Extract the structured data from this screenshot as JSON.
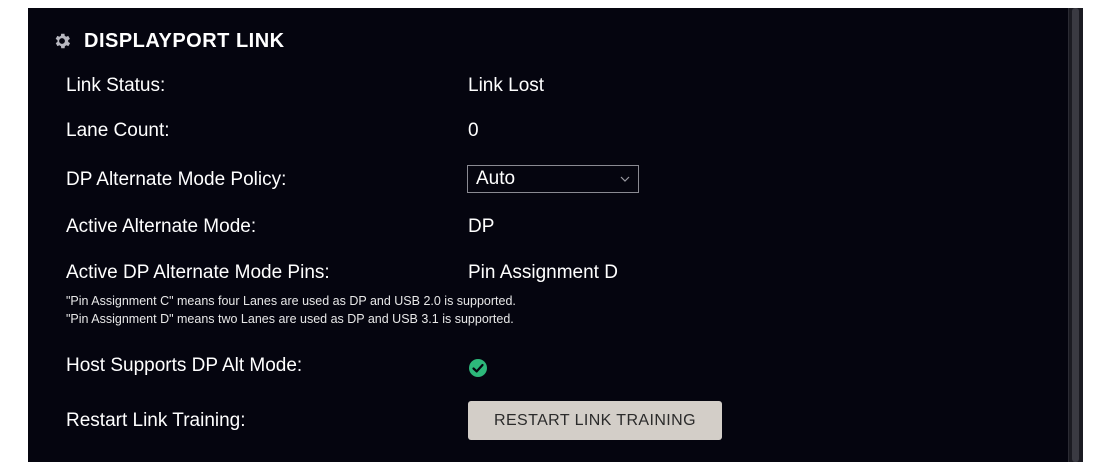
{
  "section": {
    "title": "DISPLAYPORT LINK",
    "icon": "gear-icon"
  },
  "rows": {
    "link_status": {
      "label": "Link Status:",
      "value": "Link Lost"
    },
    "lane_count": {
      "label": "Lane Count:",
      "value": "0"
    },
    "alt_mode_policy": {
      "label": "DP Alternate Mode Policy:",
      "selected": "Auto"
    },
    "active_alt_mode": {
      "label": "Active Alternate Mode:",
      "value": "DP"
    },
    "active_pins": {
      "label": "Active DP Alternate Mode Pins:",
      "value": "Pin Assignment D"
    },
    "host_supports": {
      "label": "Host Supports DP Alt Mode:",
      "status_icon": "check-circle-icon",
      "status_color": "#2db87a"
    },
    "restart": {
      "label": "Restart Link Training:",
      "button": "RESTART LINK TRAINING"
    }
  },
  "notes": {
    "pin_c": "\"Pin Assignment C\" means four Lanes are used as DP and USB 2.0 is supported.",
    "pin_d": "\"Pin Assignment D\" means two Lanes are used as DP and USB 3.1 is supported."
  },
  "colors": {
    "panel_bg": "#05050f",
    "button_bg": "#d3cec8",
    "success": "#2db87a"
  }
}
